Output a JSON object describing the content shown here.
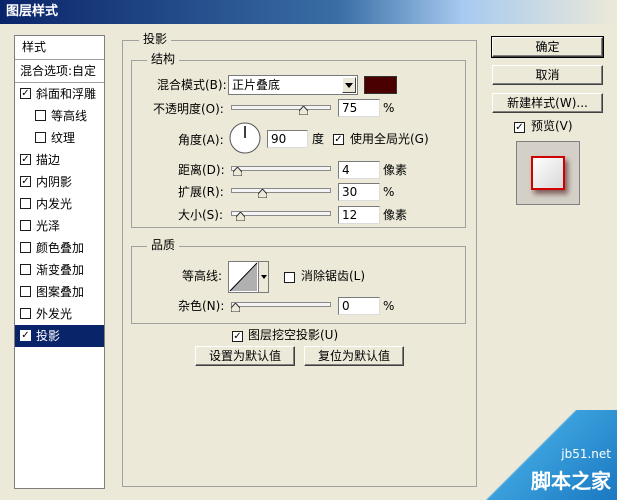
{
  "window": {
    "title": "图层样式"
  },
  "sidebar": {
    "header": "样式",
    "blend_options": "混合选项:自定",
    "items": [
      {
        "label": "斜面和浮雕",
        "checked": true,
        "indent": false,
        "selected": false
      },
      {
        "label": "等高线",
        "checked": false,
        "indent": true,
        "selected": false
      },
      {
        "label": "纹理",
        "checked": false,
        "indent": true,
        "selected": false
      },
      {
        "label": "描边",
        "checked": true,
        "indent": false,
        "selected": false
      },
      {
        "label": "内阴影",
        "checked": true,
        "indent": false,
        "selected": false
      },
      {
        "label": "内发光",
        "checked": false,
        "indent": false,
        "selected": false
      },
      {
        "label": "光泽",
        "checked": false,
        "indent": false,
        "selected": false
      },
      {
        "label": "颜色叠加",
        "checked": false,
        "indent": false,
        "selected": false
      },
      {
        "label": "渐变叠加",
        "checked": false,
        "indent": false,
        "selected": false
      },
      {
        "label": "图案叠加",
        "checked": false,
        "indent": false,
        "selected": false
      },
      {
        "label": "外发光",
        "checked": false,
        "indent": false,
        "selected": false
      },
      {
        "label": "投影",
        "checked": true,
        "indent": false,
        "selected": true
      }
    ]
  },
  "main": {
    "section_title": "投影",
    "structure": {
      "legend": "结构",
      "blend_mode_label": "混合模式(B):",
      "blend_mode_value": "正片叠底",
      "blend_color": "#4a0000",
      "opacity_label": "不透明度(O):",
      "opacity_value": "75",
      "opacity_fraction": 0.75,
      "percent": "%",
      "angle_label": "角度(A):",
      "angle_value": "90",
      "angle_unit": "度",
      "global_light_label": "使用全局光(G)",
      "global_light_checked": true,
      "distance_label": "距离(D):",
      "distance_value": "4",
      "distance_fraction": 0.02,
      "px_unit": "像素",
      "spread_label": "扩展(R):",
      "spread_value": "30",
      "spread_fraction": 0.3,
      "size_label": "大小(S):",
      "size_value": "12",
      "size_fraction": 0.05
    },
    "quality": {
      "legend": "品质",
      "contour_label": "等高线:",
      "anti_alias_label": "消除锯齿(L)",
      "anti_alias_checked": false,
      "noise_label": "杂色(N):",
      "noise_value": "0",
      "noise_fraction": 0.0
    },
    "knockout_label": "图层挖空投影(U)",
    "knockout_checked": true,
    "make_default_label": "设置为默认值",
    "reset_default_label": "复位为默认值"
  },
  "right": {
    "ok_label": "确定",
    "cancel_label": "取消",
    "new_style_label": "新建样式(W)...",
    "preview_label": "预览(V)",
    "preview_checked": true
  },
  "watermark": {
    "site": "jb51.net",
    "name": "脚本之家"
  }
}
